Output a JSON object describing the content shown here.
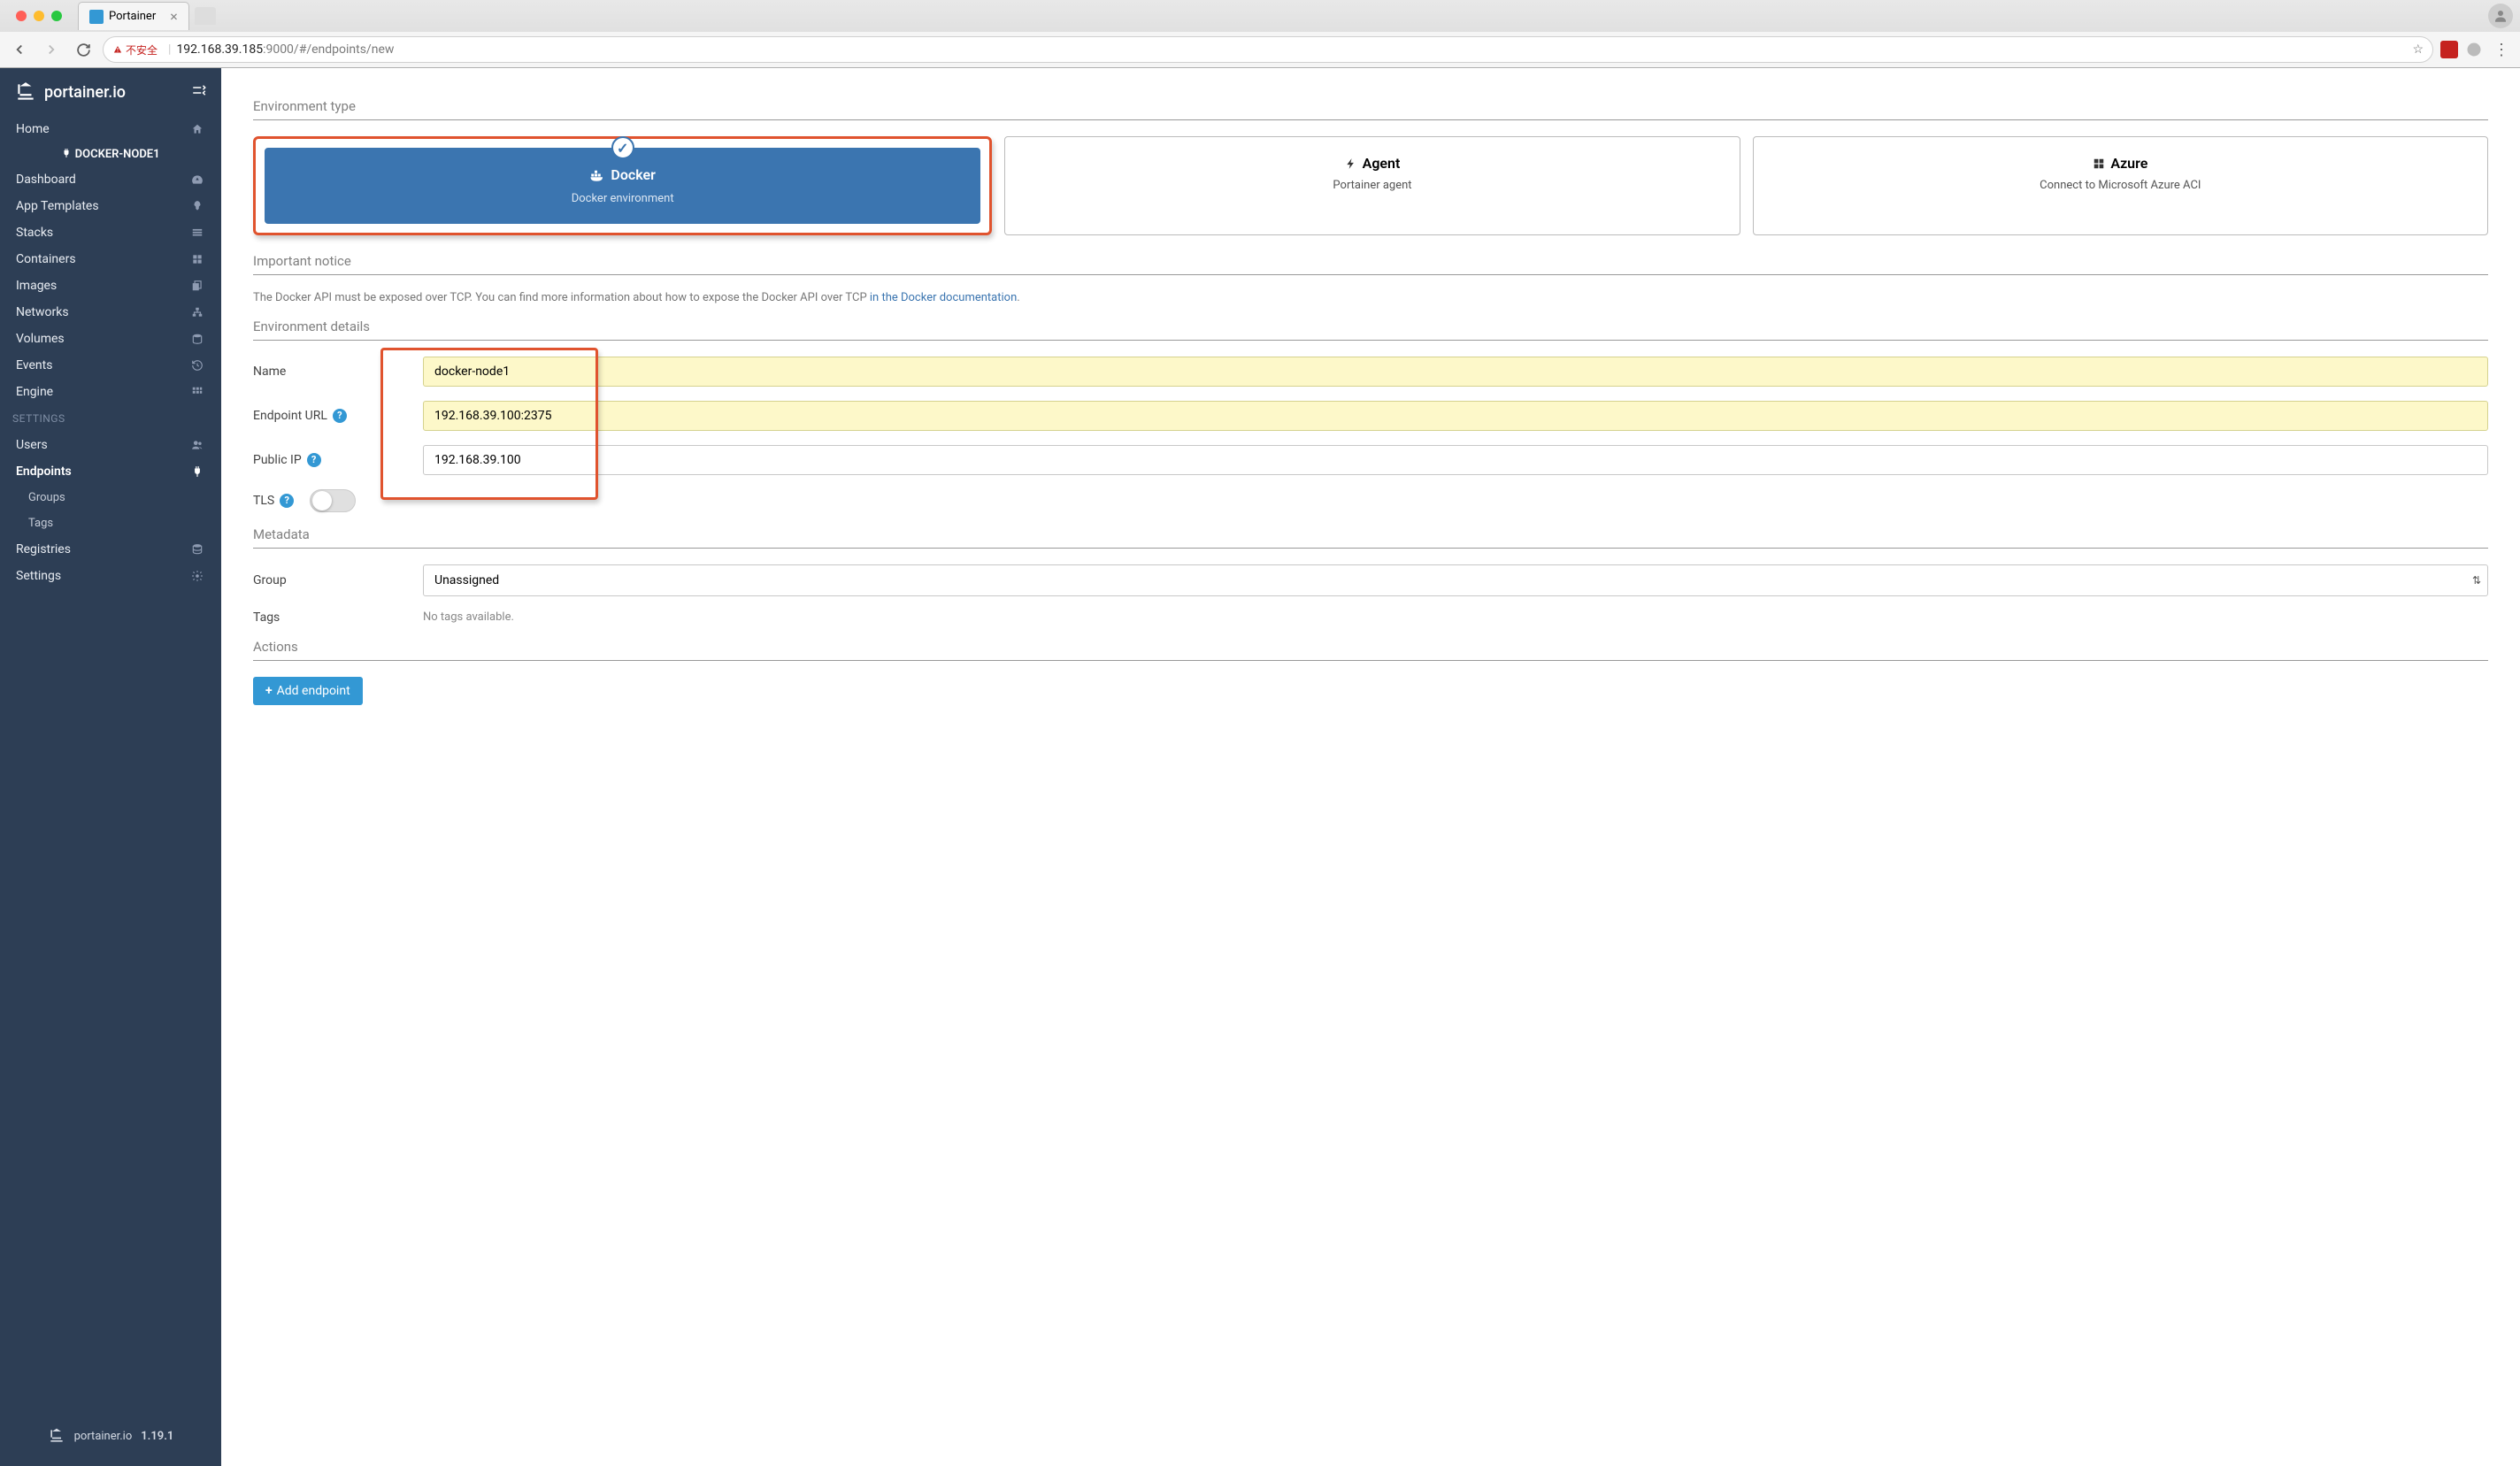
{
  "browser": {
    "tab_title": "Portainer",
    "insecure_label": "不安全",
    "url_host": "192.168.39.185",
    "url_path": ":9000/#/endpoints/new"
  },
  "sidebar": {
    "logo_text": "portainer.io",
    "version": "1.19.1",
    "docker_node": "DOCKER-NODE1",
    "items": {
      "home": "Home",
      "dashboard": "Dashboard",
      "app_templates": "App Templates",
      "stacks": "Stacks",
      "containers": "Containers",
      "images": "Images",
      "networks": "Networks",
      "volumes": "Volumes",
      "events": "Events",
      "engine": "Engine"
    },
    "settings_label": "SETTINGS",
    "settings": {
      "users": "Users",
      "endpoints": "Endpoints",
      "groups": "Groups",
      "tags": "Tags",
      "registries": "Registries",
      "settings": "Settings"
    }
  },
  "content": {
    "env_type_title": "Environment type",
    "cards": {
      "docker": {
        "title": "Docker",
        "sub": "Docker environment"
      },
      "agent": {
        "title": "Agent",
        "sub": "Portainer agent"
      },
      "azure": {
        "title": "Azure",
        "sub": "Connect to Microsoft Azure ACI"
      }
    },
    "notice_title": "Important notice",
    "notice_text": "The Docker API must be exposed over TCP. You can find more information about how to expose the Docker API over TCP ",
    "notice_link": "in the Docker documentation",
    "env_details_title": "Environment details",
    "fields": {
      "name_label": "Name",
      "name_value": "docker-node1",
      "endpoint_label": "Endpoint URL",
      "endpoint_value": "192.168.39.100:2375",
      "publicip_label": "Public IP",
      "publicip_value": "192.168.39.100",
      "tls_label": "TLS"
    },
    "metadata_title": "Metadata",
    "group_label": "Group",
    "group_value": "Unassigned",
    "tags_label": "Tags",
    "no_tags": "No tags available.",
    "actions_title": "Actions",
    "add_endpoint_btn": "Add endpoint"
  }
}
